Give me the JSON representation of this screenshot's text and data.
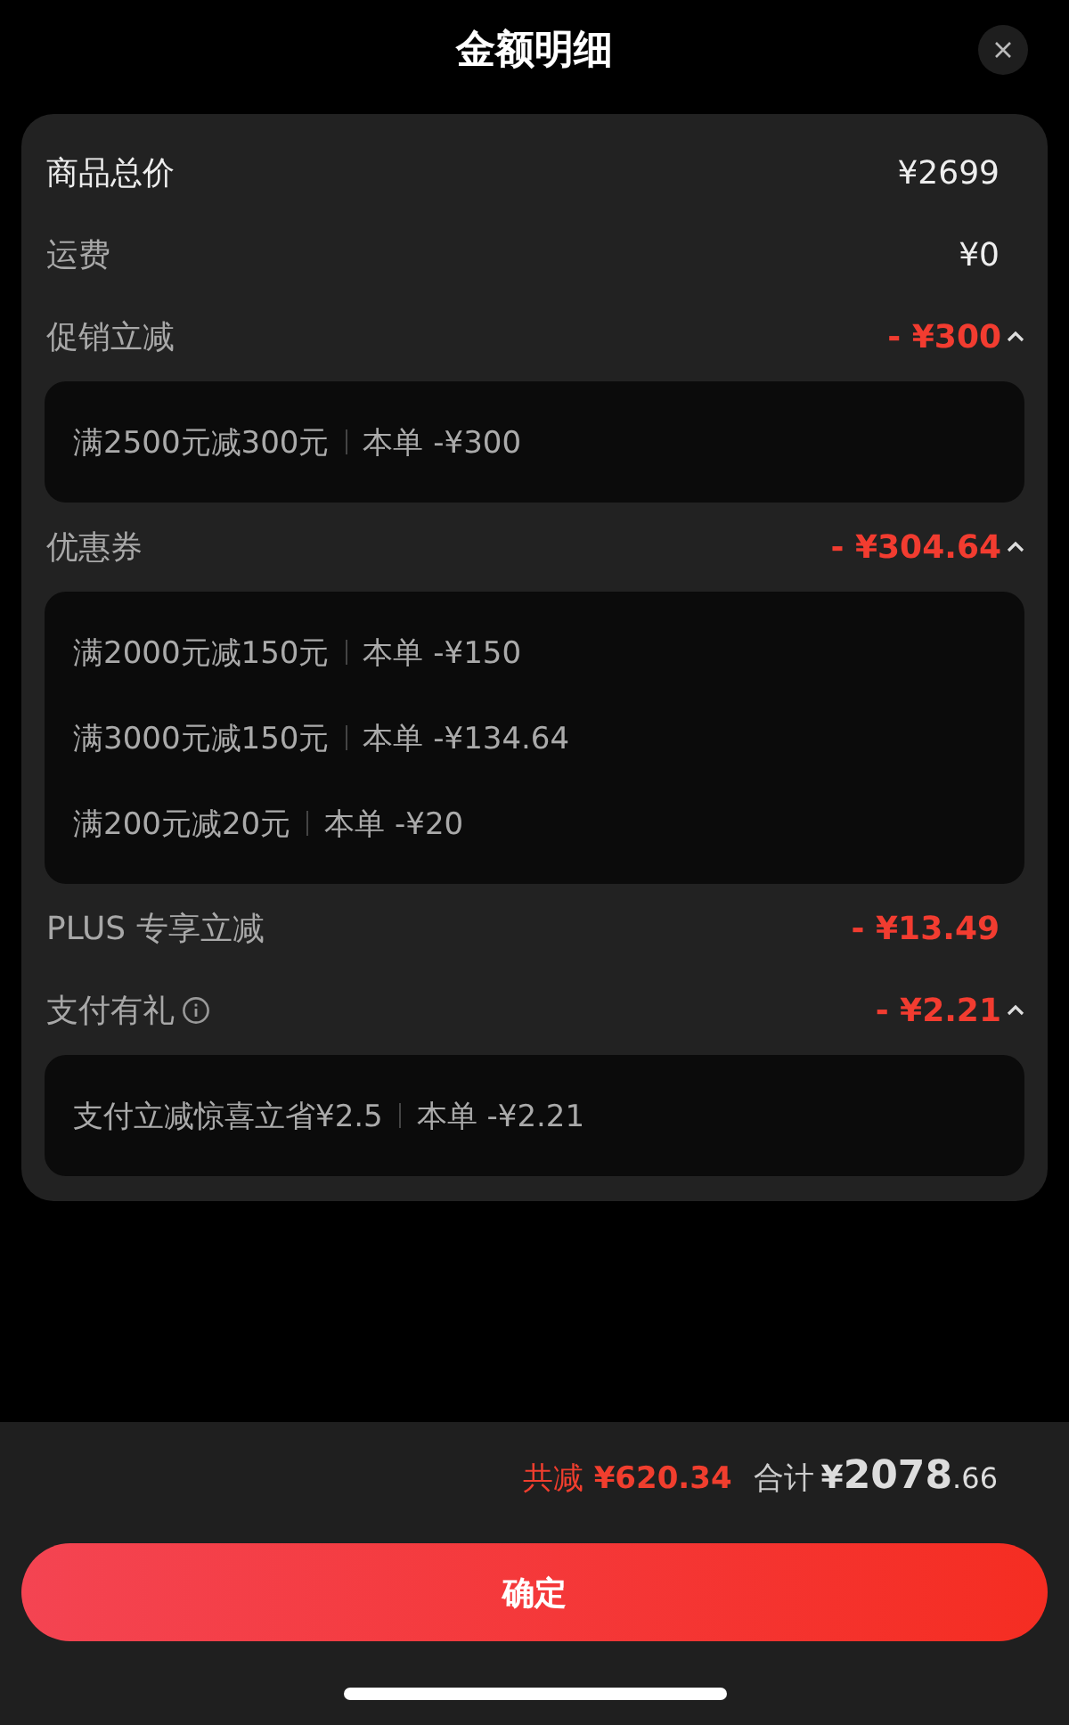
{
  "header": {
    "title": "金额明细"
  },
  "rows": [
    {
      "kind": "total",
      "label": "商品总价",
      "amount": "¥2699"
    },
    {
      "kind": "plain",
      "label": "运费",
      "amount": "¥0"
    },
    {
      "kind": "discount",
      "label": "促销立减",
      "amount": "- ¥300",
      "expanded": true,
      "details": [
        {
          "rule": "满2500元减300元",
          "amount": "本单 -¥300"
        }
      ]
    },
    {
      "kind": "discount",
      "label": "优惠券",
      "amount": "- ¥304.64",
      "expanded": true,
      "details": [
        {
          "rule": "满2000元减150元",
          "amount": "本单 -¥150"
        },
        {
          "rule": "满3000元减150元",
          "amount": "本单 -¥134.64"
        },
        {
          "rule": "满200元减20元",
          "amount": "本单 -¥20"
        }
      ]
    },
    {
      "kind": "discount",
      "label": "PLUS 专享立减",
      "amount": "- ¥13.49"
    },
    {
      "kind": "discount",
      "label": "支付有礼",
      "info": true,
      "amount": "- ¥2.21",
      "expanded": true,
      "details": [
        {
          "rule": "支付立减惊喜立省¥2.5",
          "amount": "本单 -¥2.21"
        }
      ]
    }
  ],
  "summary": {
    "savings_label": "共减",
    "savings": "¥620.34",
    "total_label": "合计",
    "currency": "¥",
    "total_integer": "2078",
    "total_decimal": ".66"
  },
  "confirm_button": "确定"
}
